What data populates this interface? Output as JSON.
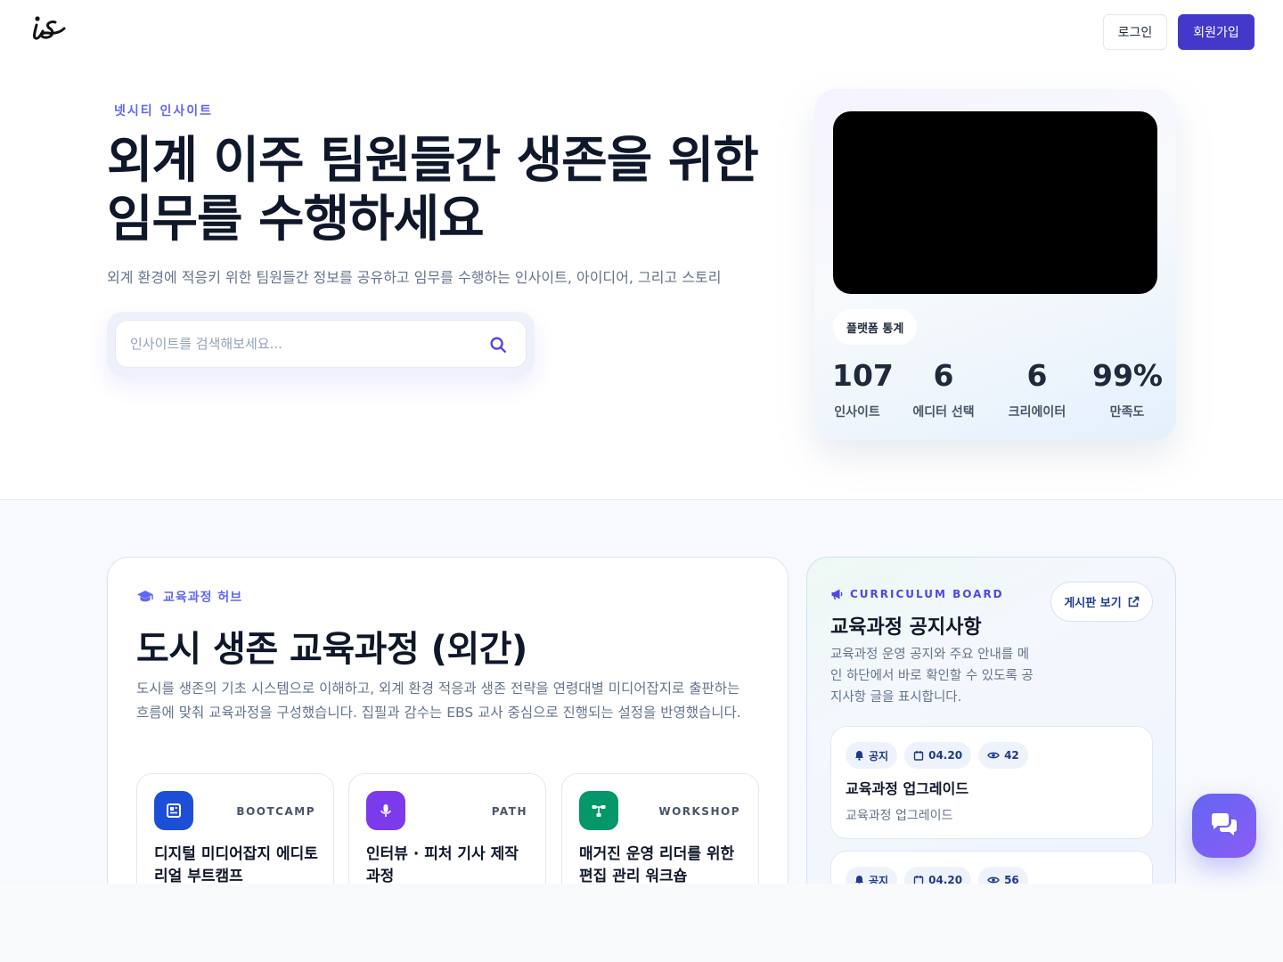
{
  "header": {
    "login_label": "로그인",
    "signup_label": "회원가입",
    "brand_color": "#4338ca"
  },
  "hero": {
    "eyebrow": "넷시티 인사이트",
    "title_line1": "외계 이주 팀원들간 생존을 위한",
    "title_line2": "임무를 수행하세요",
    "subtitle": "외계 환경에 적응키 위한 팀원들간 정보를 공유하고 임무를 수행하는 인사이트, 아이디어, 그리고 스토리",
    "search": {
      "placeholder": "인사이트를 검색해보세요...",
      "value": ""
    }
  },
  "stats": {
    "badge": "플랫폼 통계",
    "items": [
      {
        "value": "107",
        "label": "인사이트"
      },
      {
        "value": "6",
        "label": "에디터 선택"
      },
      {
        "value": "6",
        "label": "크리에이터"
      },
      {
        "value": "99%",
        "label": "만족도"
      }
    ]
  },
  "hub": {
    "eyebrow": "교육과정 허브",
    "title": "도시 생존 교육과정 (외간)",
    "description": "도시를 생존의 기초 시스템으로 이해하고, 외계 환경 적응과 생존 전략을 연령대별 미디어잡지로 출판하는 흐름에 맞춰 교육과정을 구성했습니다. 집필과 감수는 EBS 교사 중심으로 진행되는 설정을 반영했습니다.",
    "courses": [
      {
        "tag": "BOOTCAMP",
        "title": "디지털 미디어잡지 에디토리얼 부트캠프",
        "color": "#1d4ed8"
      },
      {
        "tag": "PATH",
        "title": "인터뷰 · 피처 기사 제작 과정",
        "color": "#7c3aed"
      },
      {
        "tag": "WORKSHOP",
        "title": "매거진 운영 리더를 위한 편집 관리 워크숍",
        "color": "#059669"
      }
    ]
  },
  "board": {
    "eyebrow": "CURRICULUM BOARD",
    "title": "교육과정 공지사항",
    "description": "교육과정 운영 공지와 주요 안내를 메인 하단에서 바로 확인할 수 있도록 공지사항 글을 표시합니다.",
    "view_label": "게시판 보기",
    "notices": [
      {
        "type": "공지",
        "date": "04.20",
        "views": "42",
        "title": "교육과정 업그레이드",
        "subtitle": "교육과정 업그레이드"
      },
      {
        "type": "공지",
        "date": "04.20",
        "views": "56",
        "title": "",
        "subtitle": ""
      }
    ]
  }
}
